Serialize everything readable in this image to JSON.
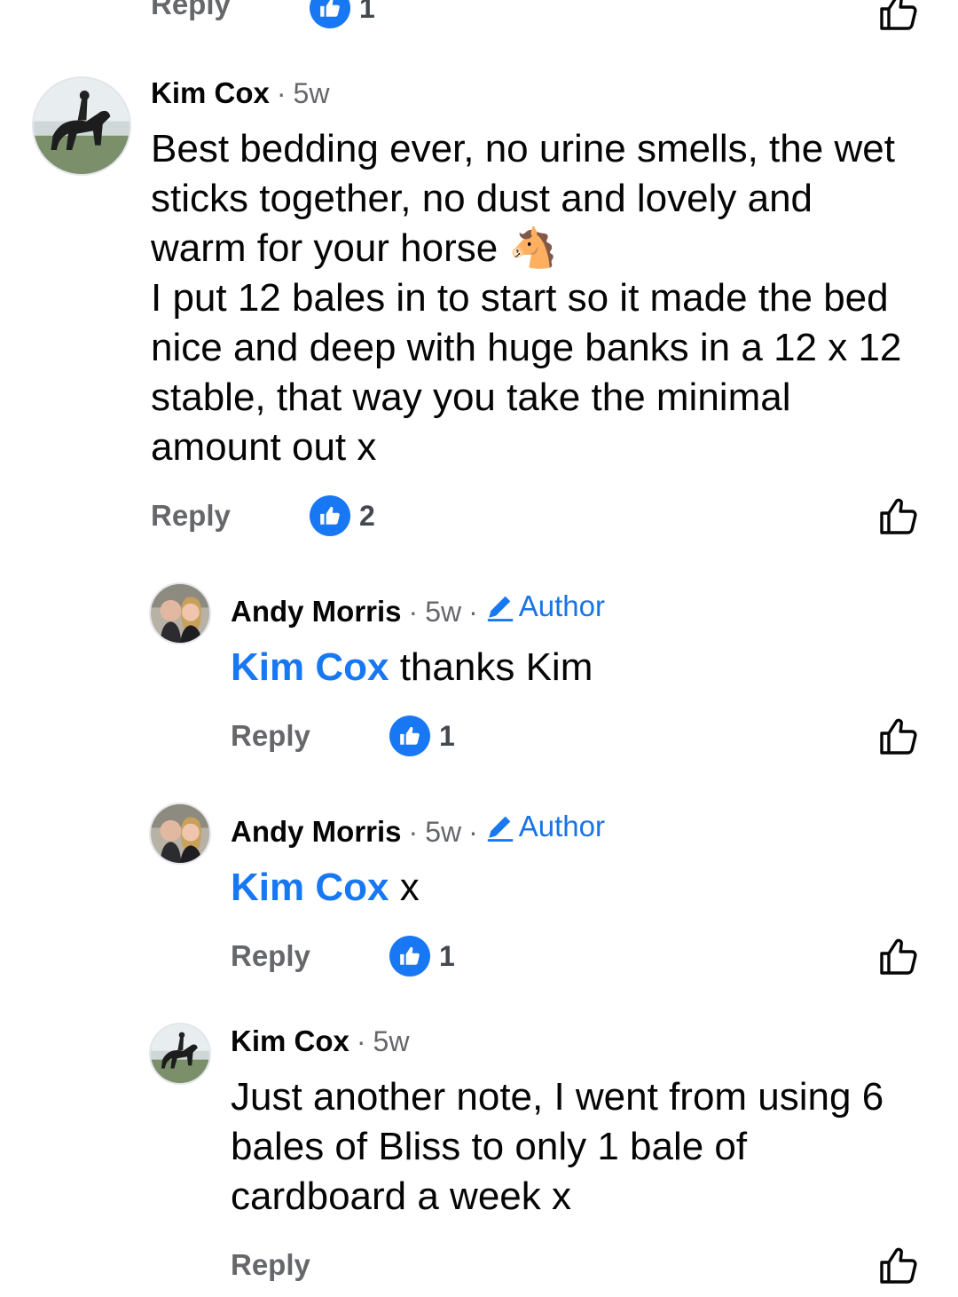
{
  "top_row": {
    "reply_label": "Reply",
    "reaction_count": "1"
  },
  "comments": [
    {
      "author": "Kim Cox",
      "time": "5w",
      "text_lines": [
        "Best bedding ever, no urine smells, the wet",
        "sticks together, no dust and lovely and",
        "warm for your horse 🐴",
        "I put 12 bales in to start so it made the bed",
        "nice and deep with huge banks in a 12 x 12",
        "stable, that way you take the minimal",
        "amount out x"
      ],
      "reply_label": "Reply",
      "reaction_count": "2"
    },
    {
      "author": "Andy Morris",
      "time": "5w",
      "badge": "Author",
      "mention": "Kim Cox",
      "text": " thanks Kim",
      "reply_label": "Reply",
      "reaction_count": "1"
    },
    {
      "author": "Andy Morris",
      "time": "5w",
      "badge": "Author",
      "mention": "Kim Cox",
      "text": " x",
      "reply_label": "Reply",
      "reaction_count": "1"
    },
    {
      "author": "Kim Cox",
      "time": "5w",
      "text_lines": [
        "Just another note, I went from using 6",
        "bales of Bliss to only 1 bale of",
        "cardboard a week x"
      ],
      "reply_label": "Reply"
    }
  ],
  "separator": "·",
  "icons": {
    "reaction": "like-reaction-icon",
    "like_button": "thumbs-up-outline-icon",
    "author_badge": "pencil-icon"
  },
  "colors": {
    "accent": "#1877f2",
    "muted": "#65676b"
  }
}
